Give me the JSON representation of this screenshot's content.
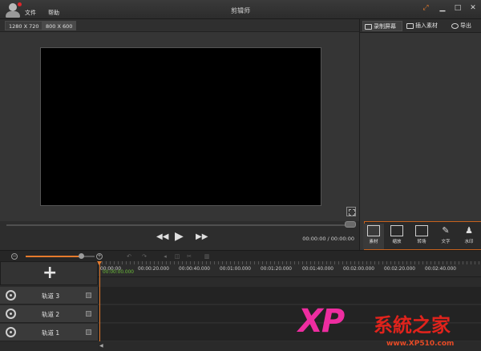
{
  "menu": {
    "file": "文件",
    "help": "帮助"
  },
  "app": {
    "title": "剪辑师"
  },
  "window": {
    "restore_icon": "⤢",
    "minimize": "▁",
    "maximize": "□",
    "close": "✕"
  },
  "resolution": {
    "options": [
      "1280 X 720",
      "800 X 600"
    ],
    "selected": "800 X 600"
  },
  "playback": {
    "progress_fraction": 0.0,
    "time": "00:00:00 / 00:00:00",
    "rewind": "◀◀",
    "play": "▶",
    "forward": "▶▶"
  },
  "right_tabs": {
    "record": "录制屏幕",
    "insert": "插入素材",
    "export": "导出"
  },
  "tools": {
    "material": "素材",
    "zoom": "缩放",
    "transition": "转场",
    "text": "文字",
    "watermark": "水印"
  },
  "timeline": {
    "zoom_fraction": 0.8,
    "zoom_out": "−",
    "zoom_in": "+",
    "add": "+",
    "ticks": [
      "00:00:00",
      "00:00:20.000",
      "00:00:40.000",
      "00:01:00.000",
      "00:01:20.000",
      "00:01:40.000",
      "00:02:00.000",
      "00:02:20.000",
      "00:02:40.000"
    ],
    "current": "00:00:00.000",
    "tracks": [
      "轨道 3",
      "轨道 2",
      "轨道 1"
    ]
  },
  "watermark": {
    "xp": "XP",
    "brand": "系統之家",
    "url": "www.XP510.com"
  },
  "colors": {
    "accent": "#e57a2c",
    "wm_pink": "#ee2da0",
    "wm_red": "#e0231c"
  }
}
